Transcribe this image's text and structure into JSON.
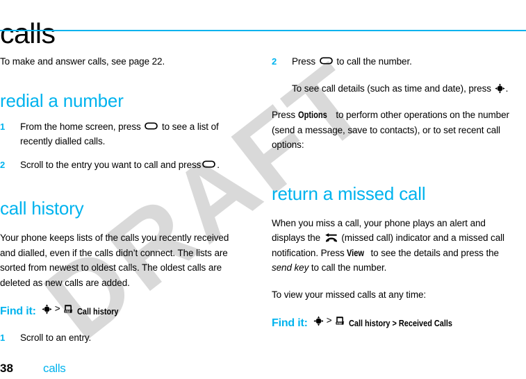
{
  "theme": {
    "accent_color": "#00b3ee",
    "text_color": "#000000",
    "watermark_color": "#d9d9d9",
    "background": "#ffffff"
  },
  "chapter": {
    "title": "calls",
    "rule": true
  },
  "watermark": {
    "text": "DRAFT"
  },
  "left_column": {
    "intro": "To make and answer calls, see page 22.",
    "redial": {
      "heading": "redial a number",
      "steps": [
        {
          "num": "1",
          "before": "From the home screen, press",
          "icon": "send-key-icon",
          "after": "to see a list of recently dialled calls."
        },
        {
          "num": "2",
          "before": "Scroll to the entry you want to call and press",
          "icon": "send-key-icon",
          "after": "."
        }
      ]
    },
    "call_history": {
      "heading": "call history",
      "paragraph": "Your phone keeps lists of the calls you recently received and dialled, even if the calls didn’t connect. The lists are sorted from newest to oldest calls. The oldest calls are deleted as new calls are added.",
      "find_it": {
        "label": "Find it:",
        "nav_icon": "nav-key-icon",
        "separator": ">",
        "menu_icon": "call-history-icon",
        "path": "Call history"
      },
      "steps": [
        {
          "num": "1",
          "before": "Scroll to an entry.",
          "icon": "",
          "after": ""
        }
      ]
    }
  },
  "right_column": {
    "redial_continued": {
      "steps": [
        {
          "num": "2",
          "before": "Press",
          "icon": "send-key-icon",
          "after": "to call the number."
        }
      ],
      "substep": {
        "before": "To see call details (such as time and date), press",
        "icon": "nav-key-icon",
        "after": "."
      },
      "options_paragraph": {
        "before": "Press",
        "ui_label": "Options",
        "after": "to perform other operations on the number (send a message, save to contacts), or to set recent call options:"
      }
    },
    "missed_call": {
      "heading": "return a missed call",
      "paragraph": {
        "part1": "When you miss a call, your phone plays an alert and displays the",
        "icon": "missed-call-icon",
        "part2": "(missed call) indicator and a missed call notification. Press",
        "ui_label": "View",
        "part3": "to see the details and press the",
        "italic": "send key",
        "part4": "to call the number."
      },
      "view_intro": "To view your missed calls at any time:",
      "find_it": {
        "label": "Find it:",
        "nav_icon": "nav-key-icon",
        "separator": ">",
        "menu_icon": "call-history-icon",
        "path": "Call history > Received Calls"
      }
    }
  },
  "footer": {
    "page_number": "38",
    "chapter_name": "calls"
  }
}
